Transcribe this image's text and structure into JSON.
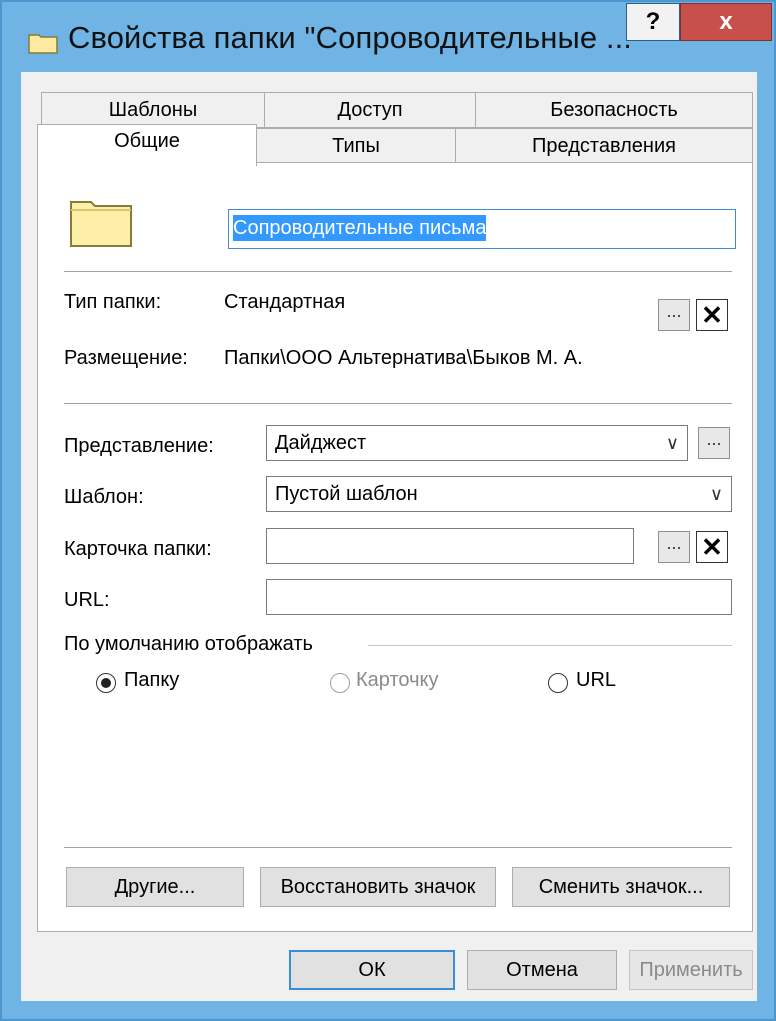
{
  "window": {
    "title": "Свойства папки \"Сопроводительные ...",
    "help_label": "?",
    "close_label": "x"
  },
  "tabs": {
    "row1": [
      "Шаблоны",
      "Доступ",
      "Безопасность"
    ],
    "row2": [
      "Общие",
      "Типы",
      "Представления"
    ],
    "active": "Общие"
  },
  "general": {
    "folder_name": "Сопроводительные письма",
    "folder_type_label": "Тип папки:",
    "folder_type_value": "Стандартная",
    "location_label": "Размещение:",
    "location_value": "Папки\\ООО Альтернатива\\Быков М. А.",
    "view_label": "Представление:",
    "view_value": "Дайджест",
    "template_label": "Шаблон:",
    "template_value": "Пустой шаблон",
    "card_label": "Карточка папки:",
    "card_value": "",
    "url_label": "URL:",
    "url_value": "",
    "default_display_label": "По умолчанию отображать",
    "radio_folder": "Папку",
    "radio_card": "Карточку",
    "radio_url": "URL",
    "browse_label": "...",
    "clear_label": "✕",
    "dropdown_arrow": "∨"
  },
  "panel_buttons": {
    "other": "Другие...",
    "restore_icon": "Восстановить значок",
    "change_icon": "Сменить значок..."
  },
  "footer": {
    "ok": "ОК",
    "cancel": "Отмена",
    "apply": "Применить"
  },
  "colors": {
    "titlebar": "#6fb4e4",
    "close": "#c7504a",
    "selection": "#3399ff",
    "focus_border": "#3c8cd6"
  }
}
